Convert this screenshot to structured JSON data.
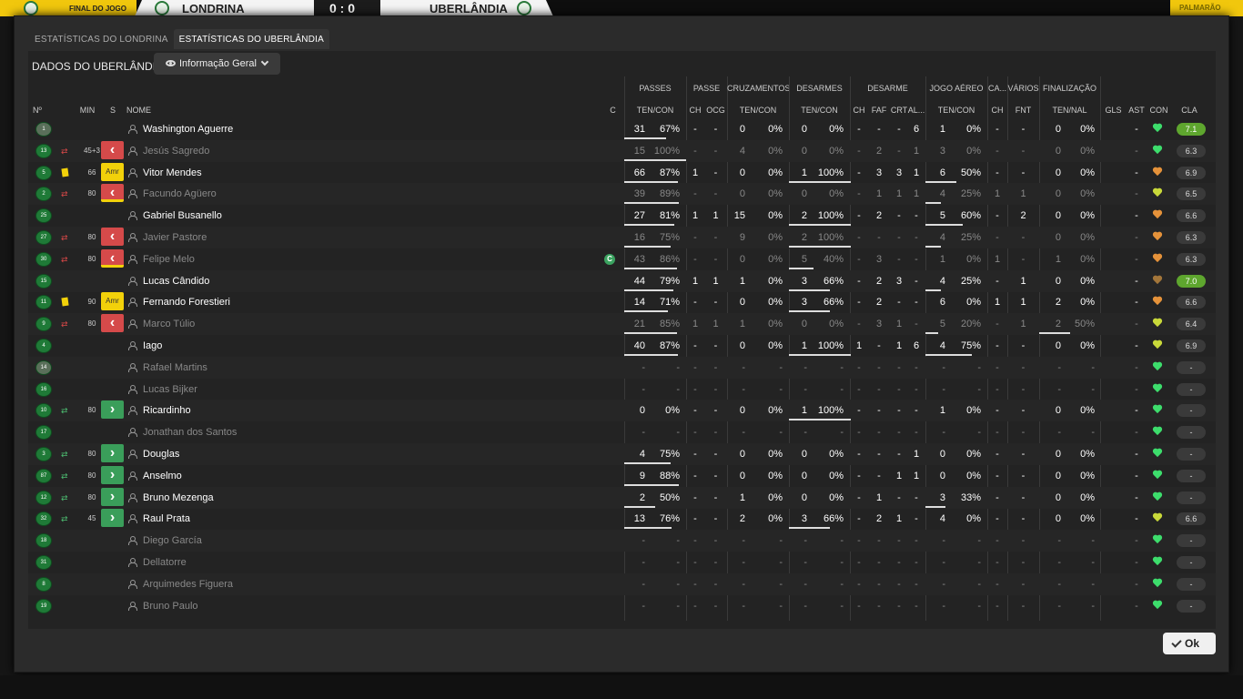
{
  "topbar": {
    "label": "FINAL DO JOGO",
    "home": "LONDRINA",
    "score": "0 : 0",
    "away": "UBERLÂNDIA",
    "right": "PALMARÃO"
  },
  "tabs": [
    {
      "label": "ESTATÍSTICAS DO LONDRINA"
    },
    {
      "label": "ESTATÍSTICAS DO UBERLÂNDIA"
    }
  ],
  "panel": {
    "title": "DADOS DO UBERLÂNDIA",
    "view": "Informação Geral"
  },
  "groups": [
    "PASSES",
    "PASSE",
    "CRUZAMENTOS",
    "DESARMES",
    "DESARME",
    "JOGO AÉREO",
    "CA...",
    "VÁRIOS",
    "FINALIZAÇÃO"
  ],
  "headers": {
    "no": "Nº",
    "min": "MIN",
    "s": "S",
    "nome": "NOME",
    "c": "C",
    "p_tc": "TEN/CON",
    "p_ch": "CH",
    "p_ocg": "OCG",
    "cr_tc": "TEN/CON",
    "de_tc": "TEN/CON",
    "d_ch": "CH",
    "d_faf": "FAF",
    "d_crt": "CRT",
    "d_al": "AL...",
    "ja_tc": "TEN/CON",
    "ca_ch": "CH",
    "v_fnt": "FNT",
    "f_tn": "TEN/NAL",
    "gls": "GLS",
    "ast": "AST",
    "con": "CON",
    "cla": "CLA"
  },
  "players": [
    {
      "no": "1",
      "min": "",
      "badge": "",
      "name": "Washington Aguerre",
      "dim": false,
      "gk": true,
      "c": "",
      "p": [
        "31",
        "67%"
      ],
      "pch": "-",
      "pocg": "-",
      "cr": [
        "0",
        "0%"
      ],
      "de": [
        "0",
        "0%"
      ],
      "dch": "-",
      "faf": "-",
      "crt": "-",
      "al": "6",
      "ja": [
        "1",
        "0%"
      ],
      "cach": "-",
      "fnt": "-",
      "fi": [
        "0",
        "0%"
      ],
      "gls": "",
      "ast": "-",
      "con": "green",
      "cla": "7.1",
      "top": true,
      "pb": 46,
      "db": 0,
      "jb": 0,
      "fb": 0,
      "sub": "",
      "yc": false
    },
    {
      "no": "13",
      "min": "45+3",
      "badge": "red",
      "name": "Jesús Sagredo",
      "dim": true,
      "gk": false,
      "c": "",
      "p": [
        "15",
        "100%"
      ],
      "pch": "-",
      "pocg": "-",
      "cr": [
        "4",
        "0%"
      ],
      "de": [
        "0",
        "0%"
      ],
      "dch": "-",
      "faf": "2",
      "crt": "-",
      "al": "1",
      "ja": [
        "3",
        "0%"
      ],
      "cach": "-",
      "fnt": "-",
      "fi": [
        "0",
        "0%"
      ],
      "gls": "",
      "ast": "-",
      "con": "green",
      "cla": "6.3",
      "top": false,
      "pb": 68,
      "db": 0,
      "jb": 0,
      "fb": 0,
      "sub": "off",
      "yc": false
    },
    {
      "no": "5",
      "min": "66",
      "badge": "amr",
      "name": "Vitor Mendes",
      "dim": false,
      "gk": false,
      "c": "",
      "p": [
        "66",
        "87%"
      ],
      "pch": "1",
      "pocg": "-",
      "cr": [
        "0",
        "0%"
      ],
      "de": [
        "1",
        "100%"
      ],
      "dch": "-",
      "faf": "3",
      "crt": "3",
      "al": "1",
      "ja": [
        "6",
        "50%"
      ],
      "cach": "-",
      "fnt": "-",
      "fi": [
        "0",
        "0%"
      ],
      "gls": "",
      "ast": "-",
      "con": "orange",
      "cla": "6.9",
      "top": false,
      "pb": 59,
      "db": 68,
      "jb": 34,
      "fb": 0,
      "sub": "",
      "yc": true
    },
    {
      "no": "2",
      "min": "80",
      "badge": "redy",
      "name": "Facundo Agüero",
      "dim": true,
      "gk": false,
      "c": "",
      "p": [
        "39",
        "89%"
      ],
      "pch": "-",
      "pocg": "-",
      "cr": [
        "0",
        "0%"
      ],
      "de": [
        "0",
        "0%"
      ],
      "dch": "-",
      "faf": "1",
      "crt": "1",
      "al": "1",
      "ja": [
        "4",
        "25%"
      ],
      "cach": "1",
      "fnt": "1",
      "fi": [
        "0",
        "0%"
      ],
      "gls": "",
      "ast": "-",
      "con": "yg",
      "cla": "6.5",
      "top": false,
      "pb": 60,
      "db": 0,
      "jb": 17,
      "fb": 0,
      "sub": "off",
      "yc": false
    },
    {
      "no": "25",
      "min": "",
      "badge": "",
      "name": "Gabriel Busanello",
      "dim": false,
      "gk": false,
      "c": "",
      "p": [
        "27",
        "81%"
      ],
      "pch": "1",
      "pocg": "1",
      "cr": [
        "15",
        "0%"
      ],
      "de": [
        "2",
        "100%"
      ],
      "dch": "-",
      "faf": "2",
      "crt": "-",
      "al": "-",
      "ja": [
        "5",
        "60%"
      ],
      "cach": "-",
      "fnt": "2",
      "fi": [
        "0",
        "0%"
      ],
      "gls": "",
      "ast": "-",
      "con": "orange",
      "cla": "6.6",
      "top": false,
      "pb": 55,
      "db": 68,
      "jb": 41,
      "fb": 0,
      "sub": "",
      "yc": false
    },
    {
      "no": "27",
      "min": "80",
      "badge": "red",
      "name": "Javier Pastore",
      "dim": true,
      "gk": false,
      "c": "",
      "p": [
        "16",
        "75%"
      ],
      "pch": "-",
      "pocg": "-",
      "cr": [
        "9",
        "0%"
      ],
      "de": [
        "2",
        "100%"
      ],
      "dch": "-",
      "faf": "-",
      "crt": "-",
      "al": "-",
      "ja": [
        "4",
        "25%"
      ],
      "cach": "-",
      "fnt": "-",
      "fi": [
        "0",
        "0%"
      ],
      "gls": "",
      "ast": "-",
      "con": "orange",
      "cla": "6.3",
      "top": false,
      "pb": 51,
      "db": 68,
      "jb": 17,
      "fb": 0,
      "sub": "off",
      "yc": false
    },
    {
      "no": "30",
      "min": "80",
      "badge": "redy",
      "name": "Felipe Melo",
      "dim": true,
      "gk": false,
      "c": "C",
      "p": [
        "43",
        "86%"
      ],
      "pch": "-",
      "pocg": "-",
      "cr": [
        "0",
        "0%"
      ],
      "de": [
        "5",
        "40%"
      ],
      "dch": "-",
      "faf": "3",
      "crt": "-",
      "al": "-",
      "ja": [
        "1",
        "0%"
      ],
      "cach": "1",
      "fnt": "-",
      "fi": [
        "1",
        "0%"
      ],
      "gls": "",
      "ast": "-",
      "con": "orange",
      "cla": "6.3",
      "top": false,
      "pb": 58,
      "db": 27,
      "jb": 0,
      "fb": 0,
      "sub": "off",
      "yc": false
    },
    {
      "no": "15",
      "min": "",
      "badge": "",
      "name": "Lucas Cândido",
      "dim": false,
      "gk": false,
      "c": "",
      "p": [
        "44",
        "79%"
      ],
      "pch": "1",
      "pocg": "1",
      "cr": [
        "1",
        "0%"
      ],
      "de": [
        "3",
        "66%"
      ],
      "dch": "-",
      "faf": "2",
      "crt": "3",
      "al": "-",
      "ja": [
        "4",
        "25%"
      ],
      "cach": "-",
      "fnt": "1",
      "fi": [
        "0",
        "0%"
      ],
      "gls": "",
      "ast": "-",
      "con": "brown",
      "cla": "7.0",
      "top": true,
      "pb": 54,
      "db": 45,
      "jb": 17,
      "fb": 0,
      "sub": "",
      "yc": false
    },
    {
      "no": "11",
      "min": "90",
      "badge": "amr",
      "name": "Fernando Forestieri",
      "dim": false,
      "gk": false,
      "c": "",
      "p": [
        "14",
        "71%"
      ],
      "pch": "-",
      "pocg": "-",
      "cr": [
        "0",
        "0%"
      ],
      "de": [
        "3",
        "66%"
      ],
      "dch": "-",
      "faf": "2",
      "crt": "-",
      "al": "-",
      "ja": [
        "6",
        "0%"
      ],
      "cach": "1",
      "fnt": "1",
      "fi": [
        "2",
        "0%"
      ],
      "gls": "",
      "ast": "-",
      "con": "orange",
      "cla": "6.6",
      "top": false,
      "pb": 48,
      "db": 45,
      "jb": 0,
      "fb": 0,
      "sub": "",
      "yc": true
    },
    {
      "no": "9",
      "min": "80",
      "badge": "red",
      "name": "Marco Túlio",
      "dim": true,
      "gk": false,
      "c": "",
      "p": [
        "21",
        "85%"
      ],
      "pch": "1",
      "pocg": "1",
      "cr": [
        "1",
        "0%"
      ],
      "de": [
        "0",
        "0%"
      ],
      "dch": "-",
      "faf": "3",
      "crt": "1",
      "al": "-",
      "ja": [
        "5",
        "20%"
      ],
      "cach": "-",
      "fnt": "1",
      "fi": [
        "2",
        "50%"
      ],
      "gls": "",
      "ast": "-",
      "con": "yg",
      "cla": "6.4",
      "top": false,
      "pb": 58,
      "db": 0,
      "jb": 14,
      "fb": 34,
      "sub": "off",
      "yc": false
    },
    {
      "no": "4",
      "min": "",
      "badge": "",
      "name": "Iago",
      "dim": false,
      "gk": false,
      "c": "",
      "p": [
        "40",
        "87%"
      ],
      "pch": "-",
      "pocg": "-",
      "cr": [
        "0",
        "0%"
      ],
      "de": [
        "1",
        "100%"
      ],
      "dch": "1",
      "faf": "-",
      "crt": "1",
      "al": "6",
      "ja": [
        "4",
        "75%"
      ],
      "cach": "-",
      "fnt": "-",
      "fi": [
        "0",
        "0%"
      ],
      "gls": "",
      "ast": "-",
      "con": "yg",
      "cla": "6.9",
      "top": false,
      "pb": 59,
      "db": 68,
      "jb": 51,
      "fb": 0,
      "sub": "",
      "yc": false
    },
    {
      "no": "14",
      "min": "",
      "badge": "",
      "name": "Rafael Martins",
      "dim": true,
      "gk": true,
      "c": "",
      "p": [
        "-",
        "-"
      ],
      "pch": "-",
      "pocg": "-",
      "cr": [
        "-",
        "-"
      ],
      "de": [
        "-",
        "-"
      ],
      "dch": "-",
      "faf": "-",
      "crt": "-",
      "al": "-",
      "ja": [
        "-",
        "-"
      ],
      "cach": "-",
      "fnt": "-",
      "fi": [
        "-",
        "-"
      ],
      "gls": "",
      "ast": "-",
      "con": "green",
      "cla": "-",
      "top": false,
      "pb": 0,
      "db": 0,
      "jb": 0,
      "fb": 0,
      "sub": "",
      "yc": false
    },
    {
      "no": "16",
      "min": "",
      "badge": "",
      "name": "Lucas Bijker",
      "dim": true,
      "gk": false,
      "c": "",
      "p": [
        "-",
        "-"
      ],
      "pch": "-",
      "pocg": "-",
      "cr": [
        "-",
        "-"
      ],
      "de": [
        "-",
        "-"
      ],
      "dch": "-",
      "faf": "-",
      "crt": "-",
      "al": "-",
      "ja": [
        "-",
        "-"
      ],
      "cach": "-",
      "fnt": "-",
      "fi": [
        "-",
        "-"
      ],
      "gls": "",
      "ast": "-",
      "con": "green",
      "cla": "-",
      "top": false,
      "pb": 0,
      "db": 0,
      "jb": 0,
      "fb": 0,
      "sub": "",
      "yc": false
    },
    {
      "no": "10",
      "min": "80",
      "badge": "green",
      "name": "Ricardinho",
      "dim": false,
      "gk": false,
      "c": "",
      "p": [
        "0",
        "0%"
      ],
      "pch": "-",
      "pocg": "-",
      "cr": [
        "0",
        "0%"
      ],
      "de": [
        "1",
        "100%"
      ],
      "dch": "-",
      "faf": "-",
      "crt": "-",
      "al": "-",
      "ja": [
        "1",
        "0%"
      ],
      "cach": "-",
      "fnt": "-",
      "fi": [
        "0",
        "0%"
      ],
      "gls": "",
      "ast": "-",
      "con": "green",
      "cla": "-",
      "top": false,
      "pb": 0,
      "db": 68,
      "jb": 0,
      "fb": 0,
      "sub": "on",
      "yc": false
    },
    {
      "no": "17",
      "min": "",
      "badge": "",
      "name": "Jonathan dos Santos",
      "dim": true,
      "gk": false,
      "c": "",
      "p": [
        "-",
        "-"
      ],
      "pch": "-",
      "pocg": "-",
      "cr": [
        "-",
        "-"
      ],
      "de": [
        "-",
        "-"
      ],
      "dch": "-",
      "faf": "-",
      "crt": "-",
      "al": "-",
      "ja": [
        "-",
        "-"
      ],
      "cach": "-",
      "fnt": "-",
      "fi": [
        "-",
        "-"
      ],
      "gls": "",
      "ast": "-",
      "con": "green",
      "cla": "-",
      "top": false,
      "pb": 0,
      "db": 0,
      "jb": 0,
      "fb": 0,
      "sub": "",
      "yc": false
    },
    {
      "no": "3",
      "min": "80",
      "badge": "green",
      "name": "Douglas",
      "dim": false,
      "gk": false,
      "c": "",
      "p": [
        "4",
        "75%"
      ],
      "pch": "-",
      "pocg": "-",
      "cr": [
        "0",
        "0%"
      ],
      "de": [
        "0",
        "0%"
      ],
      "dch": "-",
      "faf": "-",
      "crt": "-",
      "al": "1",
      "ja": [
        "0",
        "0%"
      ],
      "cach": "-",
      "fnt": "-",
      "fi": [
        "0",
        "0%"
      ],
      "gls": "",
      "ast": "-",
      "con": "green",
      "cla": "-",
      "top": false,
      "pb": 51,
      "db": 0,
      "jb": 0,
      "fb": 0,
      "sub": "on",
      "yc": false
    },
    {
      "no": "87",
      "min": "80",
      "badge": "green",
      "name": "Anselmo",
      "dim": false,
      "gk": false,
      "c": "",
      "p": [
        "9",
        "88%"
      ],
      "pch": "-",
      "pocg": "-",
      "cr": [
        "0",
        "0%"
      ],
      "de": [
        "0",
        "0%"
      ],
      "dch": "-",
      "faf": "-",
      "crt": "1",
      "al": "1",
      "ja": [
        "0",
        "0%"
      ],
      "cach": "-",
      "fnt": "-",
      "fi": [
        "0",
        "0%"
      ],
      "gls": "",
      "ast": "-",
      "con": "green",
      "cla": "-",
      "top": false,
      "pb": 60,
      "db": 0,
      "jb": 0,
      "fb": 0,
      "sub": "on",
      "yc": false
    },
    {
      "no": "12",
      "min": "80",
      "badge": "green",
      "name": "Bruno Mezenga",
      "dim": false,
      "gk": false,
      "c": "",
      "p": [
        "2",
        "50%"
      ],
      "pch": "-",
      "pocg": "-",
      "cr": [
        "1",
        "0%"
      ],
      "de": [
        "0",
        "0%"
      ],
      "dch": "-",
      "faf": "1",
      "crt": "-",
      "al": "-",
      "ja": [
        "3",
        "33%"
      ],
      "cach": "-",
      "fnt": "-",
      "fi": [
        "0",
        "0%"
      ],
      "gls": "",
      "ast": "-",
      "con": "green",
      "cla": "-",
      "top": false,
      "pb": 34,
      "db": 0,
      "jb": 22,
      "fb": 0,
      "sub": "on",
      "yc": false
    },
    {
      "no": "32",
      "min": "45",
      "badge": "green",
      "name": "Raul Prata",
      "dim": false,
      "gk": false,
      "c": "",
      "p": [
        "13",
        "76%"
      ],
      "pch": "-",
      "pocg": "-",
      "cr": [
        "2",
        "0%"
      ],
      "de": [
        "3",
        "66%"
      ],
      "dch": "-",
      "faf": "2",
      "crt": "1",
      "al": "-",
      "ja": [
        "4",
        "0%"
      ],
      "cach": "-",
      "fnt": "-",
      "fi": [
        "0",
        "0%"
      ],
      "gls": "",
      "ast": "-",
      "con": "yg",
      "cla": "6.6",
      "top": false,
      "pb": 52,
      "db": 45,
      "jb": 0,
      "fb": 0,
      "sub": "on",
      "yc": false
    },
    {
      "no": "18",
      "min": "",
      "badge": "",
      "name": "Diego García",
      "dim": true,
      "gk": false,
      "c": "",
      "p": [
        "-",
        "-"
      ],
      "pch": "-",
      "pocg": "-",
      "cr": [
        "-",
        "-"
      ],
      "de": [
        "-",
        "-"
      ],
      "dch": "-",
      "faf": "-",
      "crt": "-",
      "al": "-",
      "ja": [
        "-",
        "-"
      ],
      "cach": "-",
      "fnt": "-",
      "fi": [
        "-",
        "-"
      ],
      "gls": "",
      "ast": "-",
      "con": "green",
      "cla": "-",
      "top": false,
      "pb": 0,
      "db": 0,
      "jb": 0,
      "fb": 0,
      "sub": "",
      "yc": false
    },
    {
      "no": "31",
      "min": "",
      "badge": "",
      "name": "Dellatorre",
      "dim": true,
      "gk": false,
      "c": "",
      "p": [
        "-",
        "-"
      ],
      "pch": "-",
      "pocg": "-",
      "cr": [
        "-",
        "-"
      ],
      "de": [
        "-",
        "-"
      ],
      "dch": "-",
      "faf": "-",
      "crt": "-",
      "al": "-",
      "ja": [
        "-",
        "-"
      ],
      "cach": "-",
      "fnt": "-",
      "fi": [
        "-",
        "-"
      ],
      "gls": "",
      "ast": "-",
      "con": "green",
      "cla": "-",
      "top": false,
      "pb": 0,
      "db": 0,
      "jb": 0,
      "fb": 0,
      "sub": "",
      "yc": false
    },
    {
      "no": "8",
      "min": "",
      "badge": "",
      "name": "Arquimedes Figuera",
      "dim": true,
      "gk": false,
      "c": "",
      "p": [
        "-",
        "-"
      ],
      "pch": "-",
      "pocg": "-",
      "cr": [
        "-",
        "-"
      ],
      "de": [
        "-",
        "-"
      ],
      "dch": "-",
      "faf": "-",
      "crt": "-",
      "al": "-",
      "ja": [
        "-",
        "-"
      ],
      "cach": "-",
      "fnt": "-",
      "fi": [
        "-",
        "-"
      ],
      "gls": "",
      "ast": "-",
      "con": "green",
      "cla": "-",
      "top": false,
      "pb": 0,
      "db": 0,
      "jb": 0,
      "fb": 0,
      "sub": "",
      "yc": false
    },
    {
      "no": "19",
      "min": "",
      "badge": "",
      "name": "Bruno Paulo",
      "dim": true,
      "gk": false,
      "c": "",
      "p": [
        "-",
        "-"
      ],
      "pch": "-",
      "pocg": "-",
      "cr": [
        "-",
        "-"
      ],
      "de": [
        "-",
        "-"
      ],
      "dch": "-",
      "faf": "-",
      "crt": "-",
      "al": "-",
      "ja": [
        "-",
        "-"
      ],
      "cach": "-",
      "fnt": "-",
      "fi": [
        "-",
        "-"
      ],
      "gls": "",
      "ast": "-",
      "con": "green",
      "cla": "-",
      "top": false,
      "pb": 0,
      "db": 0,
      "jb": 0,
      "fb": 0,
      "sub": "",
      "yc": false
    }
  ],
  "ok": "Ok"
}
